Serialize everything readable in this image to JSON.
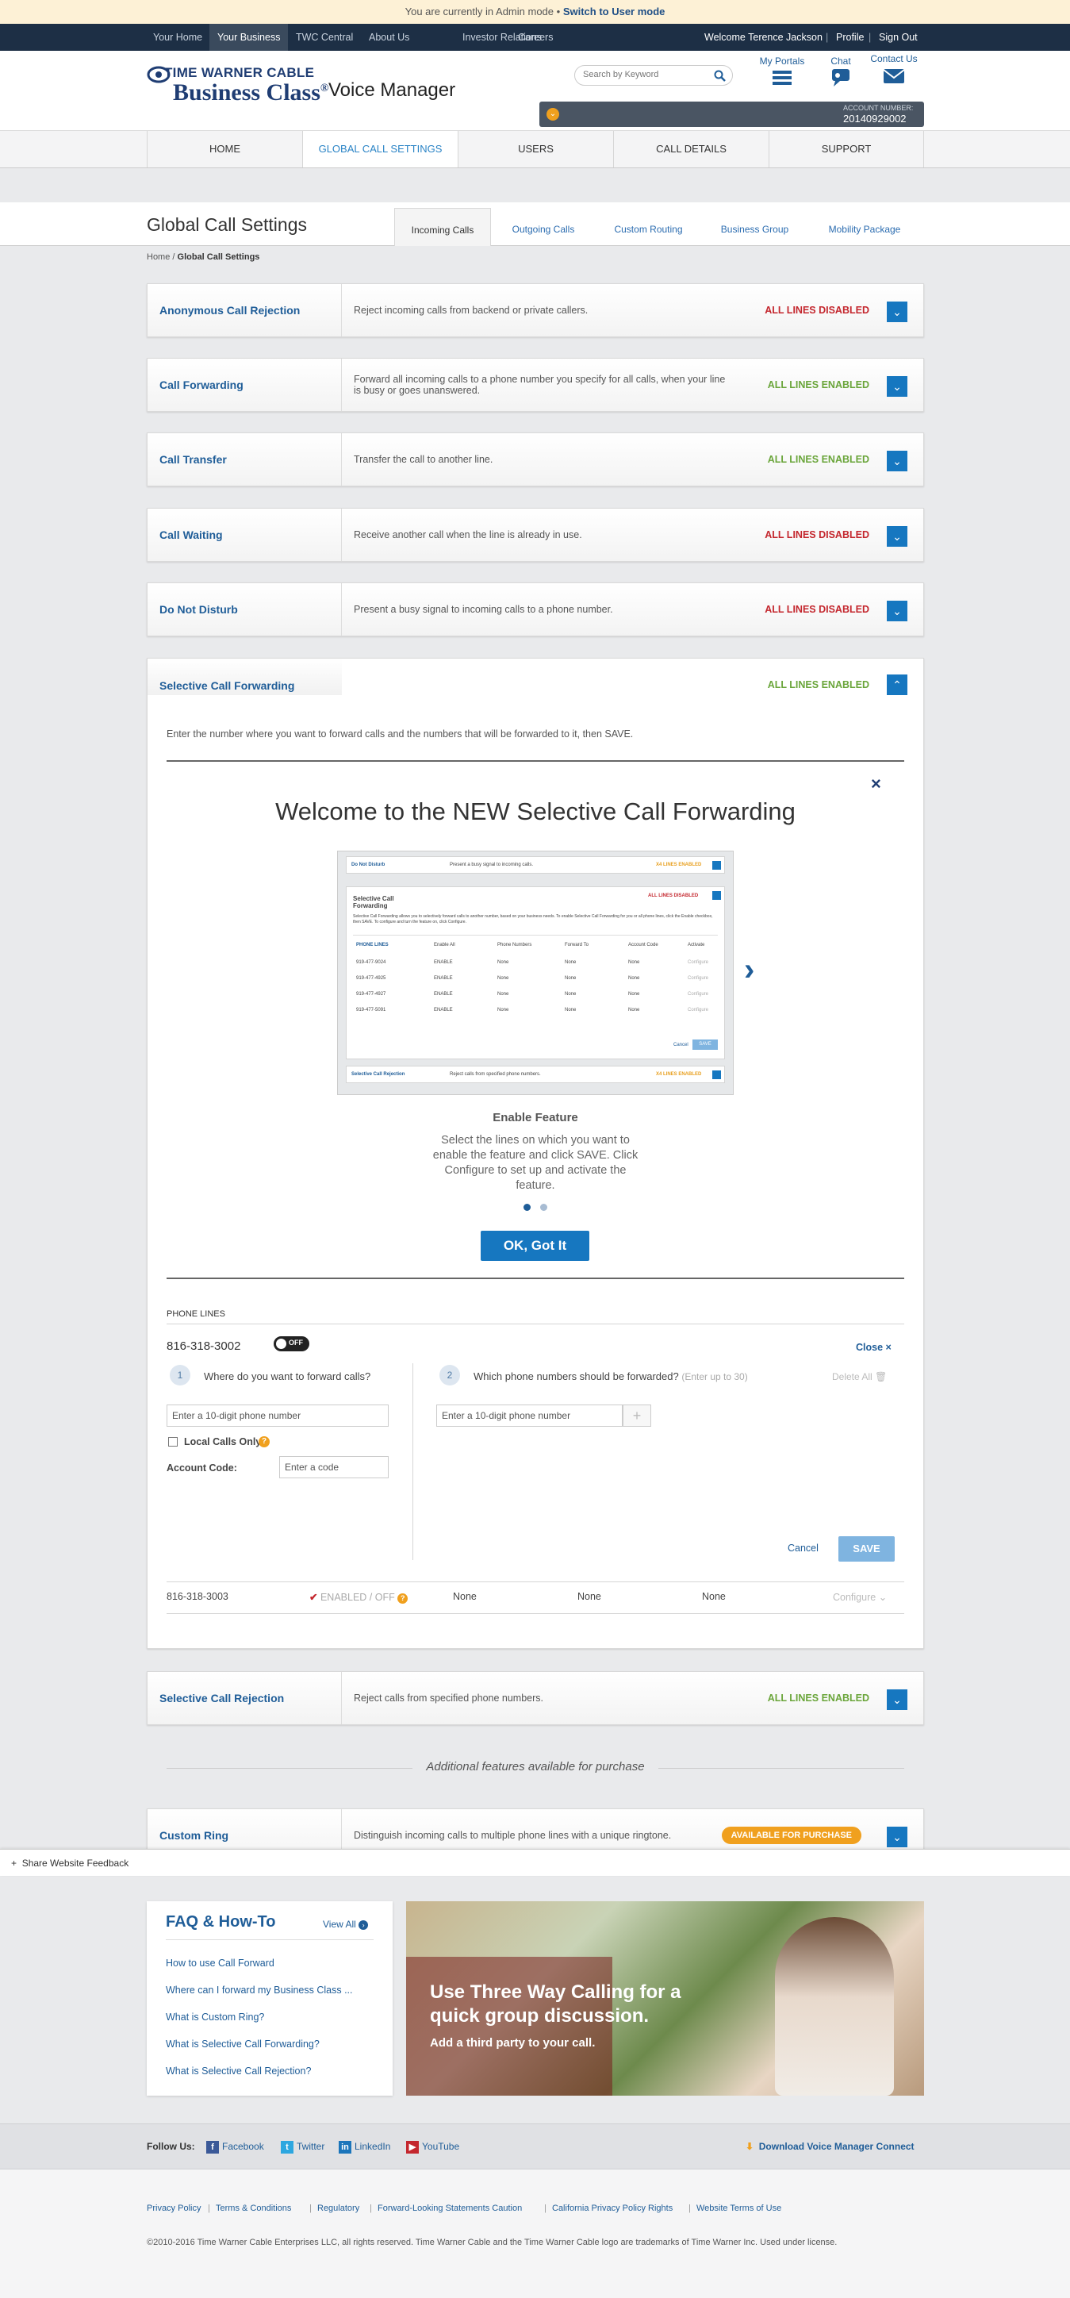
{
  "admin_bar": {
    "text": "You are currently in Admin mode •",
    "link": "Switch to User mode"
  },
  "top_nav": {
    "items": [
      "Your Home",
      "Your Business",
      "TWC Central",
      "About Us",
      "Investor Relations",
      "Careers"
    ],
    "welcome": "Welcome Terence Jackson",
    "profile": "Profile",
    "sign_out": "Sign Out"
  },
  "header": {
    "logo_line1": "TIME WARNER CABLE",
    "logo_line2": "Business Class",
    "logo_reg": "®",
    "app_name": "Voice Manager",
    "search_placeholder": "Search by Keyword",
    "my_portals": "My Portals",
    "chat": "Chat",
    "contact_us": "Contact Us",
    "account_label": "ACCOUNT NUMBER:",
    "account_number": "20140929002"
  },
  "main_nav": [
    "HOME",
    "GLOBAL CALL SETTINGS",
    "USERS",
    "CALL DETAILS",
    "SUPPORT"
  ],
  "page": {
    "title": "Global Call Settings",
    "tabs": [
      "Incoming Calls",
      "Outgoing Calls",
      "Custom Routing",
      "Business Group",
      "Mobility Package"
    ],
    "breadcrumb_home": "Home",
    "breadcrumb_sep": " / ",
    "breadcrumb_current": "Global Call Settings"
  },
  "features": [
    {
      "name": "Anonymous Call Rejection",
      "desc": "Reject incoming calls from backend or private callers.",
      "status": "ALL LINES DISABLED"
    },
    {
      "name": "Call Forwarding",
      "desc": "Forward all incoming calls to a phone number you specify for all calls, when your line is busy or goes unanswered.",
      "status": "ALL LINES ENABLED"
    },
    {
      "name": "Call Transfer",
      "desc": "Transfer the call to another line.",
      "status": "ALL LINES ENABLED"
    },
    {
      "name": "Call Waiting",
      "desc": "Receive another call when the line is already in use.",
      "status": "ALL LINES DISABLED"
    },
    {
      "name": "Do Not Disturb",
      "desc": "Present a busy signal to incoming calls to a phone number.",
      "status": "ALL LINES DISABLED"
    }
  ],
  "scf": {
    "name": "Selective Call Forwarding",
    "status": "ALL LINES ENABLED",
    "instruction": "Enter the number where you want to forward calls and the numbers that will be forwarded to it, then SAVE.",
    "modal": {
      "title": "Welcome to the NEW Selective Call Forwarding",
      "step_title": "Enable Feature",
      "step_text": "Select the lines on which you want to enable the feature and click SAVE. Click Configure to set up and activate the feature.",
      "ok": "OK, Got It",
      "close": "×",
      "next": "›",
      "shot": {
        "row1_name": "Do Not Disturb",
        "row1_desc": "Present a busy signal to incoming calls.",
        "row1_status": "X4 LINES ENABLED",
        "name": "Selective Call Forwarding",
        "status": "ALL LINES DISABLED",
        "desc": "Selective Call Forwarding allows you to selectively forward calls to another number, based on your business needs. To enable Selective Call Forwarding for you or all phone lines, click the Enable checkbox, then SAVE. To configure and turn the feature on, click Configure.",
        "headers": [
          "PHONE LINES",
          "Enable All",
          "Phone Numbers",
          "Forward To",
          "Account Code",
          "Activate"
        ],
        "rows": [
          [
            "919-477-9024",
            "ENABLE",
            "None",
            "None",
            "None",
            "Configure"
          ],
          [
            "919-477-4925",
            "ENABLE",
            "None",
            "None",
            "None",
            "Configure"
          ],
          [
            "919-477-4927",
            "ENABLE",
            "None",
            "None",
            "None",
            "Configure"
          ],
          [
            "919-477-5091",
            "ENABLE",
            "None",
            "None",
            "None",
            "Configure"
          ]
        ],
        "cancel": "Cancel",
        "save": "SAVE",
        "row2_name": "Selective Call Rejection",
        "row2_desc": "Reject calls from specified phone numbers.",
        "row2_status": "X4 LINES ENABLED"
      }
    },
    "phone_lines_label": "PHONE LINES",
    "line1": {
      "number": "816-318-3002",
      "toggle": "OFF",
      "close": "Close",
      "q1_num": "1",
      "q1": "Where do you want to forward calls?",
      "q1_placeholder": "Enter a 10-digit phone number",
      "local_only": "Local Calls Only",
      "account_code_label": "Account Code:",
      "account_code_placeholder": "Enter a code",
      "q2_num": "2",
      "q2": "Which phone numbers should be forwarded?",
      "q2_hint": "(Enter up to 30)",
      "delete_all": "Delete All",
      "q2_placeholder": "Enter a 10-digit phone number",
      "cancel": "Cancel",
      "save": "SAVE"
    },
    "line2": {
      "number": "816-318-3003",
      "status": "ENABLED / OFF",
      "col1": "None",
      "col2": "None",
      "col3": "None",
      "configure": "Configure"
    }
  },
  "scr": {
    "name": "Selective Call Rejection",
    "desc": "Reject calls from specified phone numbers.",
    "status": "ALL LINES ENABLED"
  },
  "additional": "Additional features available for purchase",
  "custom_ring": {
    "name": "Custom Ring",
    "desc": "Distinguish incoming calls to multiple phone lines with a unique ringtone.",
    "status": "AVAILABLE FOR PURCHASE"
  },
  "feedback": "Share Website Feedback",
  "faq": {
    "title": "FAQ & How-To",
    "view_all": "View All",
    "links": [
      "How to use Call Forward",
      "Where can I forward my Business Class ...",
      "What is Custom Ring?",
      "What is Selective Call Forwarding?",
      "What is Selective Call Rejection?"
    ]
  },
  "promo": {
    "headline": "Use Three Way Calling for a quick group discussion.",
    "sub": "Add a third party to your call."
  },
  "follow": {
    "label": "Follow Us:",
    "items": [
      "Facebook",
      "Twitter",
      "LinkedIn",
      "YouTube"
    ],
    "download": "Download Voice Manager Connect"
  },
  "footer": {
    "links": [
      "Privacy Policy",
      "Terms & Conditions",
      "Regulatory",
      "Forward-Looking Statements Caution",
      "California Privacy Policy Rights",
      "Website Terms of Use"
    ],
    "copyright": "©2010-2016 Time Warner Cable Enterprises LLC, all rights reserved. Time Warner Cable and the Time Warner Cable logo are trademarks of Time Warner Inc. Used under license."
  },
  "colors": {
    "brand": "#1f3d73",
    "accent": "#1677c0",
    "disabled": "#c4272e",
    "enabled": "#6aa53a",
    "purchase": "#f0a01e"
  }
}
